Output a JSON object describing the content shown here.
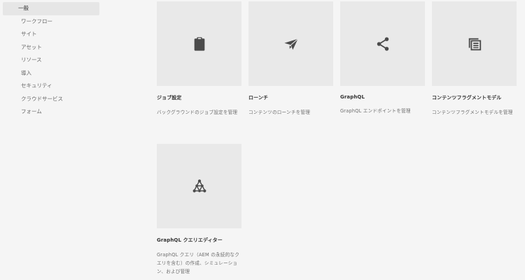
{
  "sidebar": {
    "items": [
      {
        "label": "一般",
        "active": true
      },
      {
        "label": "ワークフロー"
      },
      {
        "label": "サイト"
      },
      {
        "label": "アセット"
      },
      {
        "label": "リソース"
      },
      {
        "label": "導入"
      },
      {
        "label": "セキュリティ"
      },
      {
        "label": "クラウドサービス"
      },
      {
        "label": "フォーム"
      }
    ]
  },
  "cards": [
    {
      "title": "ジョブ設定",
      "desc": "バックグラウンドのジョブ設定を管理",
      "icon": "clipboard-icon"
    },
    {
      "title": "ローンチ",
      "desc": "コンテンツのローンチを管理",
      "icon": "paper-plane-icon"
    },
    {
      "title": "GraphQL",
      "desc": "GraphQL エンドポイントを管理",
      "icon": "share-icon"
    },
    {
      "title": "コンテンツフラグメントモデル",
      "desc": "コンテンツフラグメントモデルを管理",
      "icon": "fragment-model-icon"
    },
    {
      "title": "GraphQL クエリエディター",
      "desc": "GraphQL クエリ（AEM の永続的なクエリを含む）の作成、シミュレーション、および管理",
      "icon": "graph-network-icon"
    }
  ],
  "colors": {
    "background": "#f5f5f5",
    "thumb": "#e9e9e9",
    "icon": "#4b4b4b",
    "active_nav": "#e6e6e6"
  }
}
